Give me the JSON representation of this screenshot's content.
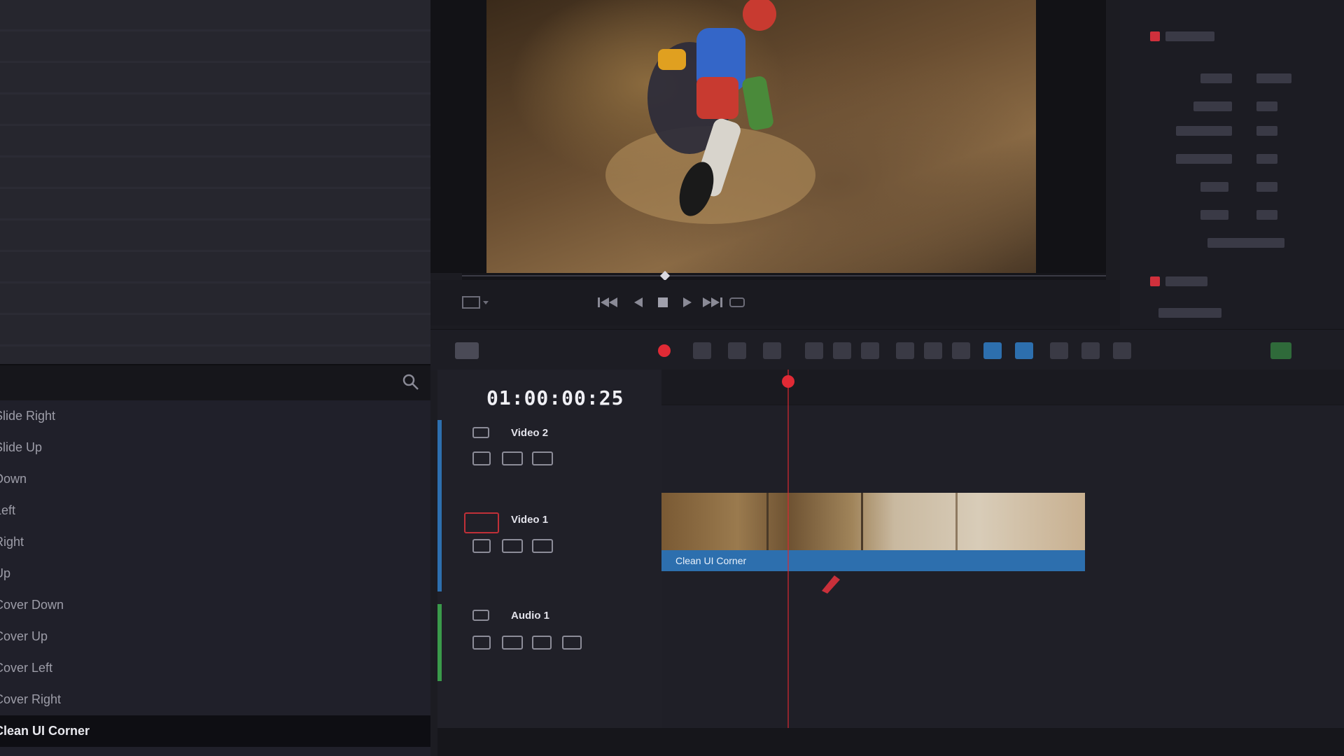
{
  "effects_panel": {
    "search_placeholder": "",
    "items": [
      {
        "label": "Slide Right",
        "selected": false
      },
      {
        "label": "Slide Up",
        "selected": false
      },
      {
        "label": "Down",
        "selected": false
      },
      {
        "label": "Left",
        "selected": false
      },
      {
        "label": "Right",
        "selected": false
      },
      {
        "label": "Up",
        "selected": false
      },
      {
        "label": "Cover Down",
        "selected": false
      },
      {
        "label": "Cover Up",
        "selected": false
      },
      {
        "label": "Cover Left",
        "selected": false
      },
      {
        "label": "Cover Right",
        "selected": false
      },
      {
        "label": "Clean UI Corner",
        "selected": true
      }
    ]
  },
  "timeline": {
    "timecode": "01:00:00:25",
    "tracks": [
      {
        "name": "Video 2",
        "color": "#2d6fae"
      },
      {
        "name": "Video 1",
        "color": "#2d6fae"
      },
      {
        "name": "Audio 1",
        "color": "#3a9a4a"
      }
    ],
    "clip_label": "Clean UI Corner",
    "playhead_color": "#e02a35"
  },
  "colors": {
    "accent_red": "#e02a35",
    "clip_blue": "#2d6fae",
    "panel_bg": "#1c1c22"
  }
}
